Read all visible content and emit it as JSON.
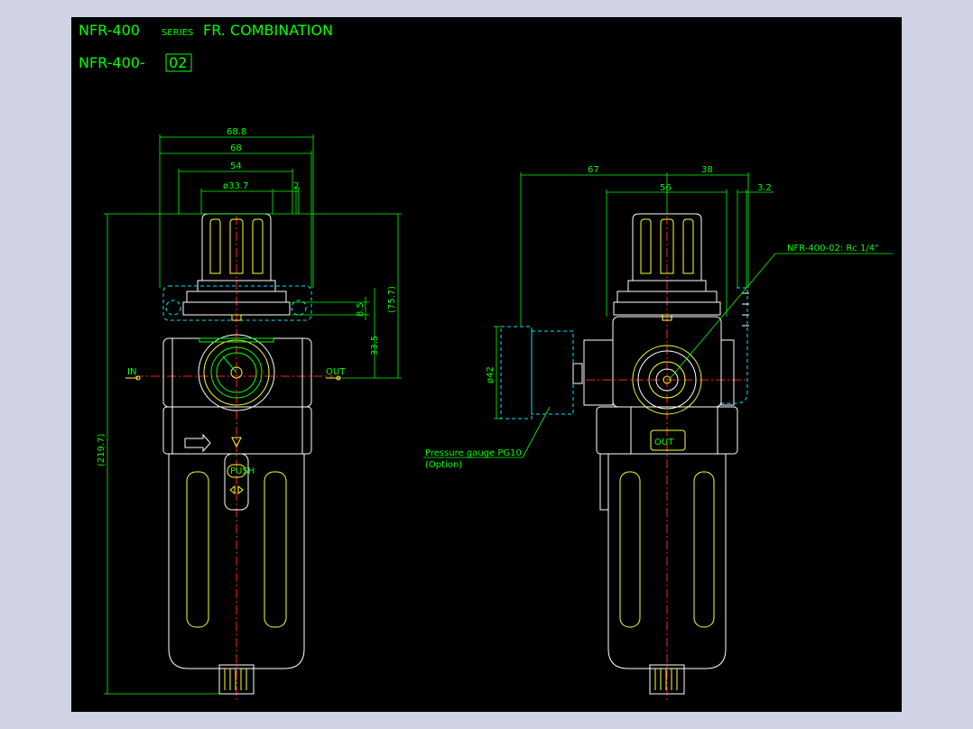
{
  "title": {
    "main": "NFR-400",
    "series": "SERIES",
    "rest": "FR. COMBINATION",
    "model_prefix": "NFR-400-",
    "model_code": "02"
  },
  "dimensions": {
    "d68_8": "68.8",
    "d68": "68",
    "d54": "54",
    "d33_7": "ø33.7",
    "d2": "2",
    "d8_5": "8.5",
    "d75_7": "(75.7)",
    "d33_5": "33.5",
    "d219_7": "(219.7)",
    "d67": "67",
    "d38": "38",
    "d56": "56",
    "d3_2": "3.2",
    "d42": "ø42"
  },
  "labels": {
    "in": "IN",
    "out": "OUT",
    "out_port": "OUT",
    "push": "PUSH",
    "callout_port": "NFR-400-02: Rc 1/4\"",
    "gauge_line1": "Pressure gauge PG10",
    "gauge_line2": "(Option)"
  },
  "colors": {
    "background": "#000000",
    "frame": "#cfd3e4",
    "dimension": "#00ff00",
    "outline": "#ffffff",
    "detail": "#ffff33",
    "hidden": "#00e5ff",
    "centerline": "#ff2020"
  }
}
